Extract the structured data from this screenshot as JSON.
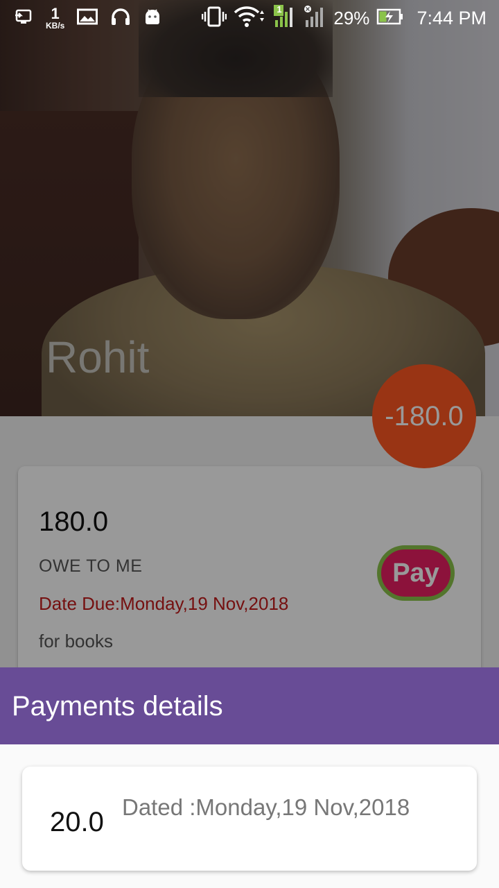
{
  "status_bar": {
    "network_speed_value": "1",
    "network_speed_unit": "KB/s",
    "sim1_label": "1",
    "battery_percent": "29%",
    "time": "7:44 PM",
    "icons": [
      "cast-icon",
      "image-icon",
      "headset-icon",
      "android-icon",
      "vibrate-icon",
      "wifi-icon",
      "signal-icon",
      "signal-no-sim-icon",
      "battery-charging-icon"
    ]
  },
  "profile": {
    "name": "Rohit",
    "balance_badge": "-180.0"
  },
  "due_card": {
    "amount": "180.0",
    "type_label": "OWE TO ME",
    "due_text": "Date Due:Monday,19 Nov,2018",
    "note": "for books",
    "pay_label": "Pay"
  },
  "payments_sheet": {
    "title": "Payments details",
    "items": [
      {
        "amount": "20.0",
        "dated": "Dated :Monday,19 Nov,2018"
      }
    ]
  },
  "colors": {
    "sheet_header": "#684c96",
    "badge": "#ff5722",
    "pay_button": "#e91e63",
    "pay_border": "#8bc34a",
    "due_text": "#c41b1b"
  }
}
